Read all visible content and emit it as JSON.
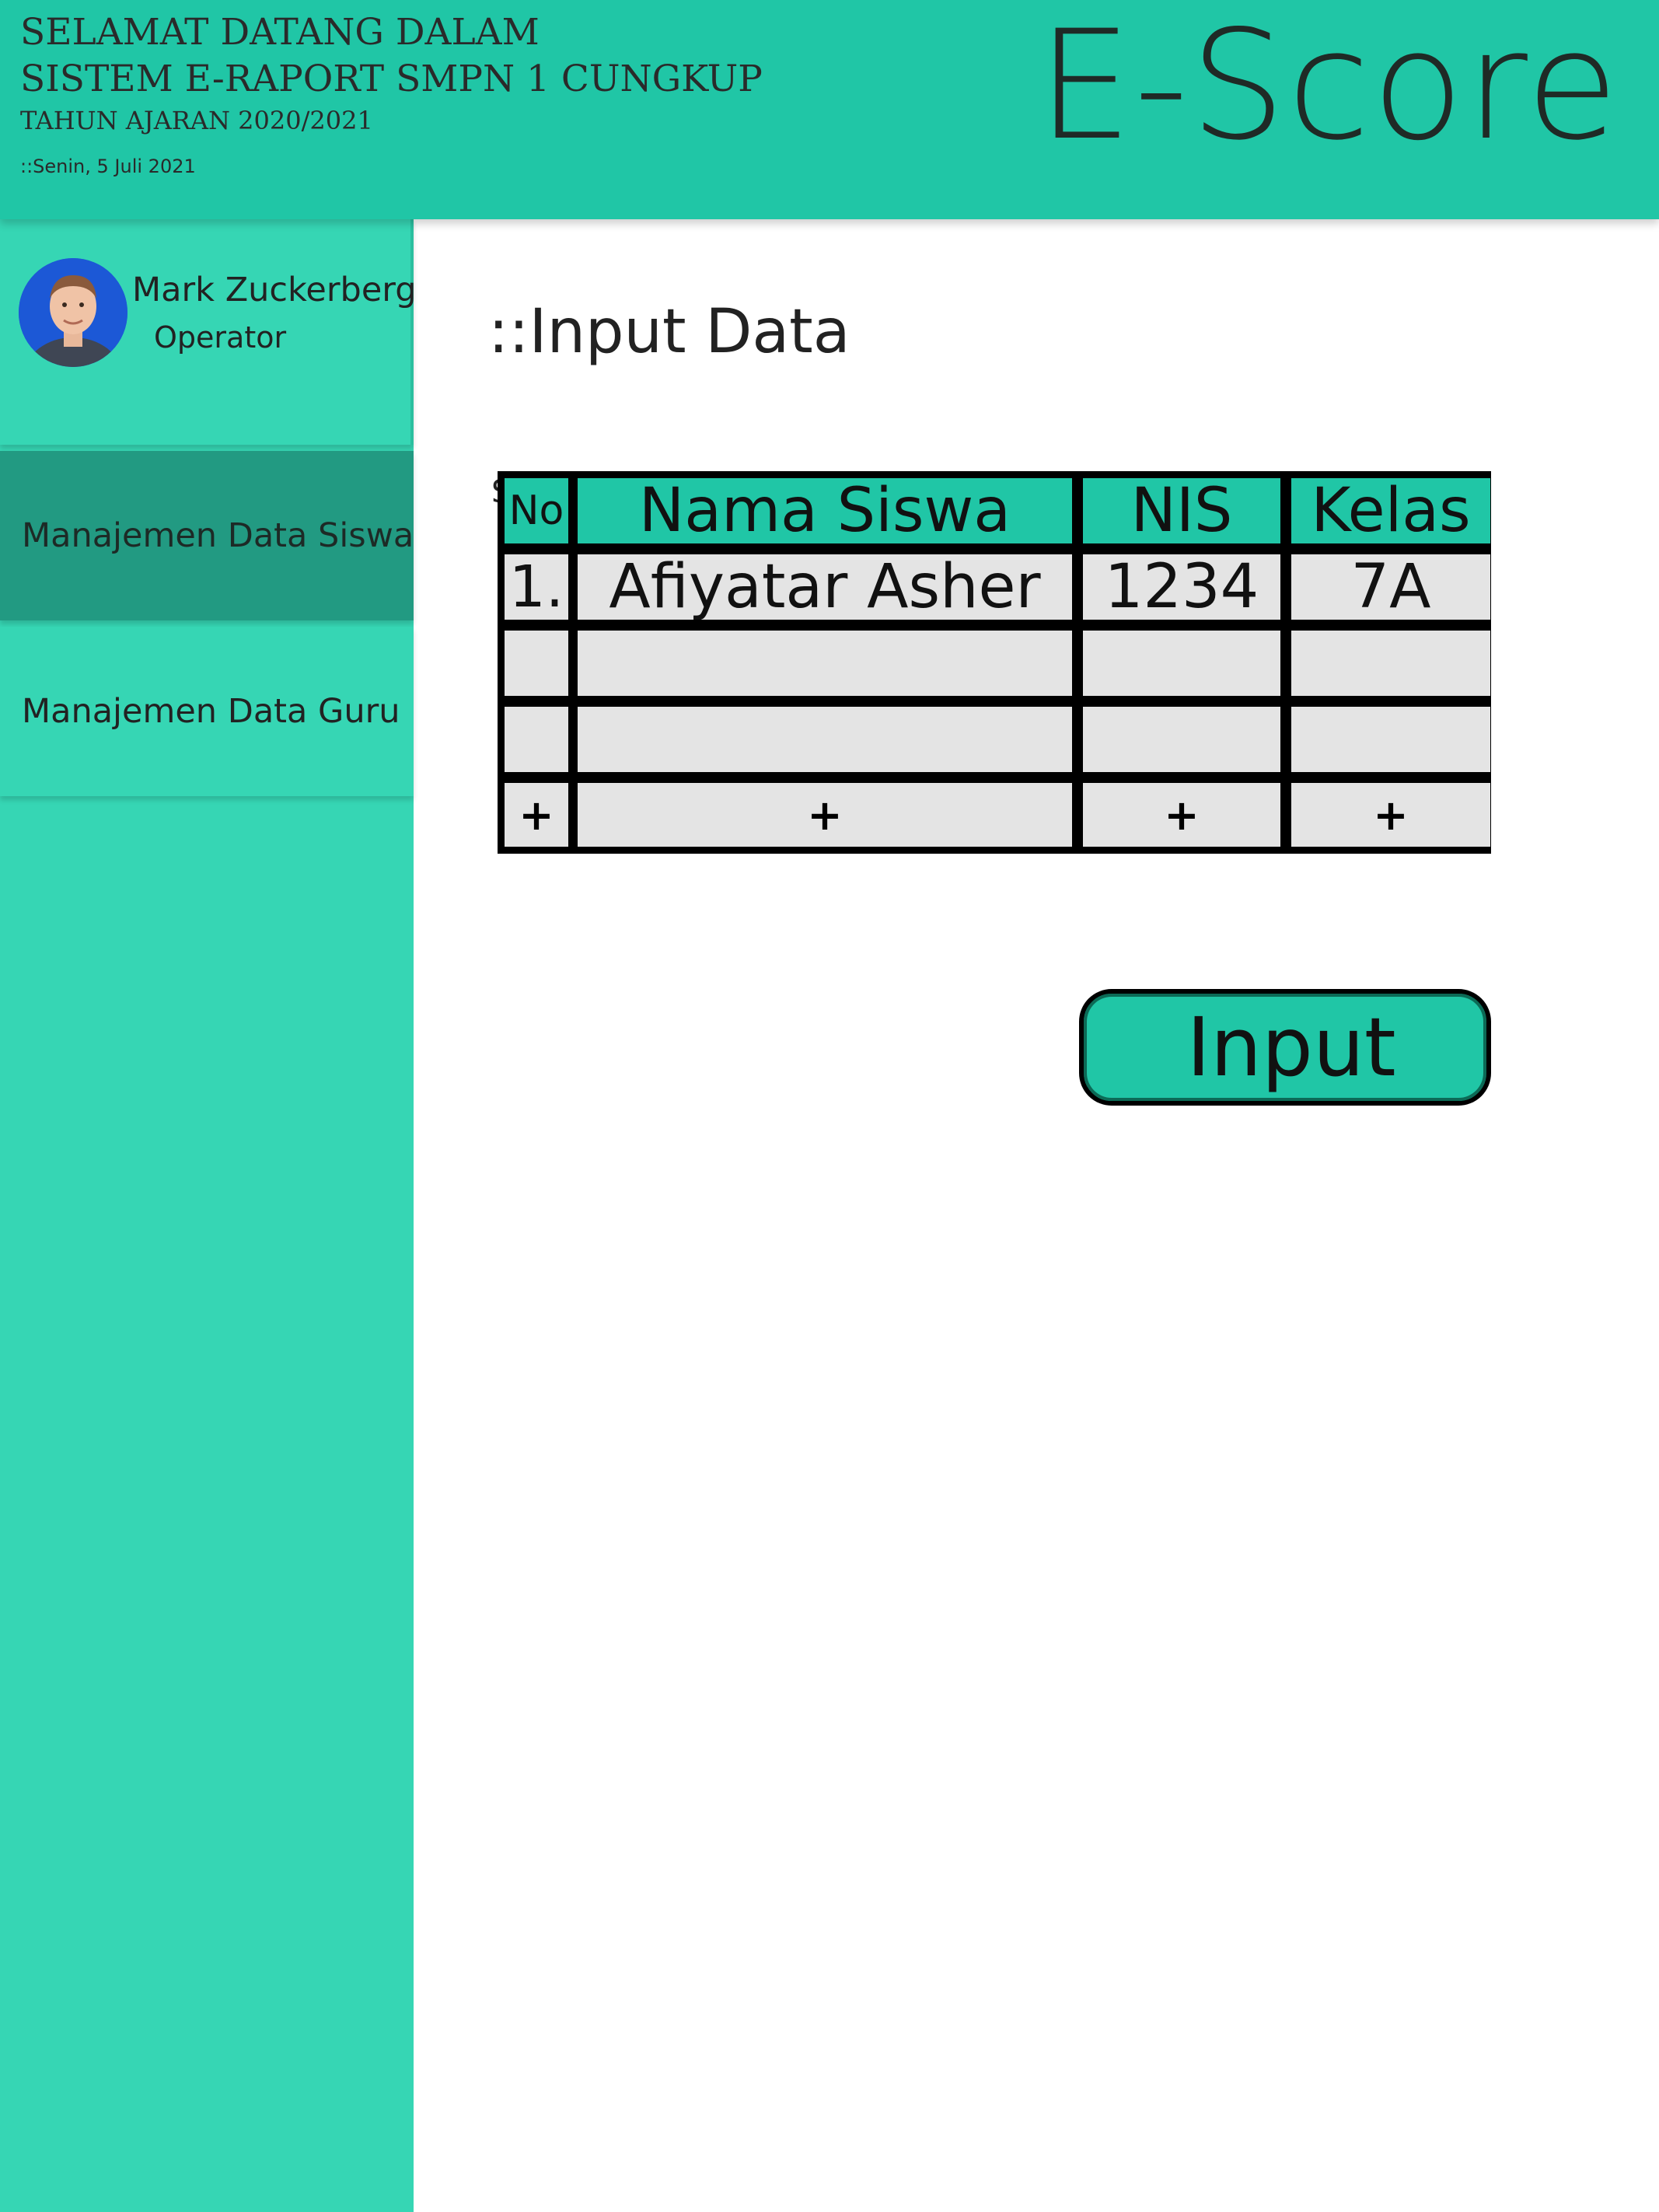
{
  "header": {
    "welcome_line1": "SELAMAT DATANG DALAM",
    "welcome_line2": "SISTEM E-RAPORT SMPN 1 CUNGKUP",
    "school_year": "TAHUN AJARAN 2020/2021",
    "date": "::Senin, 5 Juli 2021",
    "brand": "E-Score"
  },
  "sidebar": {
    "user": {
      "name": "Mark Zuckerberg",
      "role": "Operator"
    },
    "items": [
      {
        "label": "Manajemen Data Siswa",
        "active": true
      },
      {
        "label": "Manajemen Data Guru",
        "active": false
      }
    ]
  },
  "main": {
    "title": "::Input Data",
    "stray_mark": "S",
    "table": {
      "columns": [
        "No",
        "Nama Siswa",
        "NIS",
        "Kelas"
      ],
      "rows": [
        [
          "1.",
          "Afiyatar Asher",
          "1234",
          "7A"
        ],
        [
          "",
          "",
          "",
          ""
        ],
        [
          "",
          "",
          "",
          ""
        ]
      ],
      "add_symbol": "+"
    },
    "input_button": "Input"
  },
  "colors": {
    "header_bg": "#20c6a6",
    "sidebar_bg": "#36d6b4",
    "active_item_bg": "#229a82",
    "cell_bg": "#e4e4e4"
  }
}
